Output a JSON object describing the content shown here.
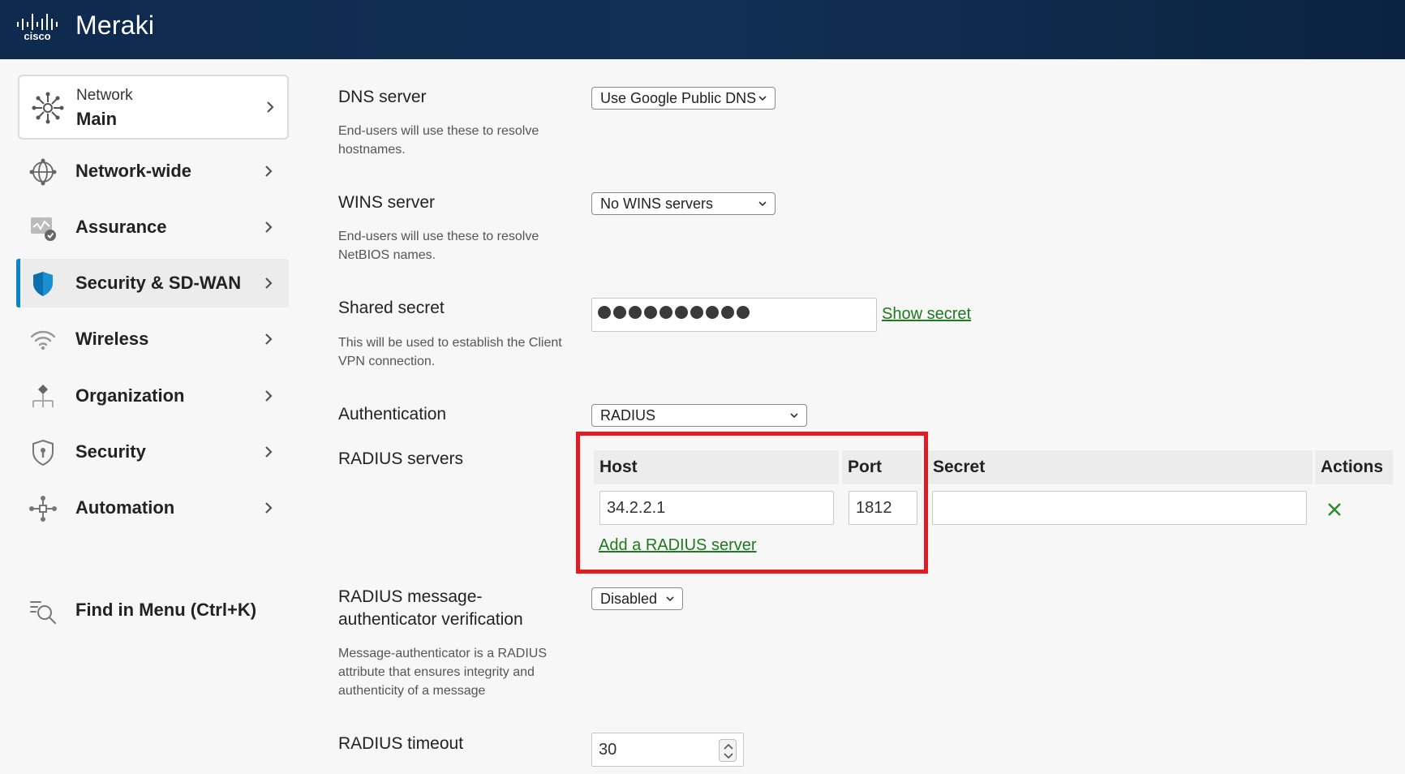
{
  "header": {
    "title": "Meraki",
    "logo_text": "cisco"
  },
  "sidebar": {
    "network_card": {
      "kicker": "Network",
      "name": "Main"
    },
    "items": [
      {
        "label": "Network-wide",
        "icon": "globe-network-icon"
      },
      {
        "label": "Assurance",
        "icon": "assurance-icon"
      },
      {
        "label": "Security & SD-WAN",
        "icon": "shield-icon",
        "active": true
      },
      {
        "label": "Wireless",
        "icon": "wifi-icon"
      },
      {
        "label": "Organization",
        "icon": "organization-icon"
      },
      {
        "label": "Security",
        "icon": "security-shield-icon"
      },
      {
        "label": "Automation",
        "icon": "automation-icon"
      }
    ],
    "find": {
      "label": "Find in Menu (Ctrl+K)",
      "icon": "search-list-icon"
    }
  },
  "form": {
    "dns": {
      "label": "DNS server",
      "help": "End-users will use these to resolve hostnames.",
      "value": "Use Google Public DNS"
    },
    "wins": {
      "label": "WINS server",
      "help": "End-users will use these to resolve NetBIOS names.",
      "value": "No WINS servers"
    },
    "shared_secret": {
      "label": "Shared secret",
      "help": "This will be used to establish the Client VPN connection.",
      "masked_length": 10,
      "show_link": "Show secret"
    },
    "authentication": {
      "label": "Authentication",
      "value": "RADIUS"
    },
    "radius_servers": {
      "label": "RADIUS servers",
      "columns": {
        "host": "Host",
        "port": "Port",
        "secret": "Secret",
        "actions": "Actions"
      },
      "rows": [
        {
          "host": "34.2.2.1",
          "port": "1812",
          "secret": ""
        }
      ],
      "add_link": "Add a RADIUS server"
    },
    "msg_auth": {
      "label": "RADIUS message-authenticator verification",
      "help": "Message-authenticator is a RADIUS attribute that ensures integrity and authenticity of a message",
      "value": "Disabled"
    },
    "timeout": {
      "label": "RADIUS timeout",
      "value": "30"
    }
  },
  "colors": {
    "header_bg": "#0e2a4e",
    "accent": "#0b85c7",
    "link": "#1d7a1d",
    "highlight": "#e31b23"
  }
}
